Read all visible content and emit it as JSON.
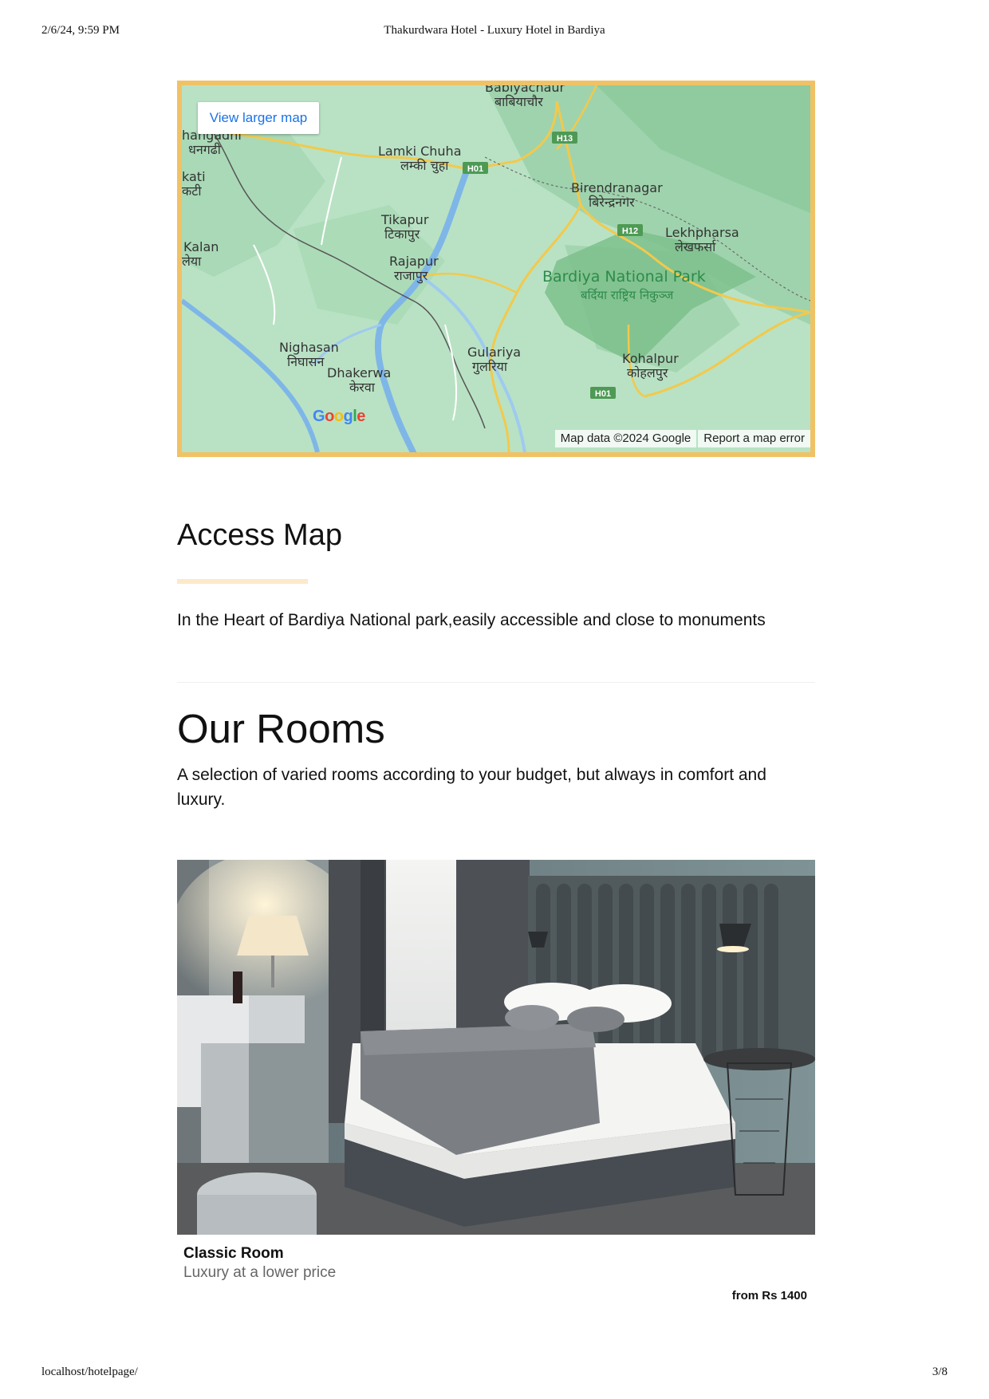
{
  "print_header": {
    "datetime": "2/6/24, 9:59 PM",
    "title": "Thakurdwara Hotel - Luxury Hotel in Bardiya"
  },
  "print_footer": {
    "url": "localhost/hotelpage/",
    "page": "3/8"
  },
  "map": {
    "button_label": "View larger map",
    "attribution": "Map data ©2024 Google",
    "report_label": "Report a map error",
    "logo_text": "Google",
    "places": [
      {
        "name": "Babiyachaur",
        "native": "बाबियाचौर"
      },
      {
        "name": "hangadhi",
        "native": "धनगढी"
      },
      {
        "name": "Lamki Chuha",
        "native": "लम्की चुहा"
      },
      {
        "name": "Birendranagar",
        "native": "बिरेन्द्रनगर"
      },
      {
        "name": "kati",
        "native": "कटी"
      },
      {
        "name": "Tikapur",
        "native": "टिकापुर"
      },
      {
        "name": "Lekhpharsa",
        "native": "लेखफर्सा"
      },
      {
        "name": "Kalan",
        "native": "लेया"
      },
      {
        "name": "Rajapur",
        "native": "राजापुर"
      },
      {
        "name": "Bardiya National Park",
        "native": "बर्दिया राष्ट्रिय निकुञ्ज"
      },
      {
        "name": "Nighasan",
        "native": "निघासन"
      },
      {
        "name": "Gulariya",
        "native": "गुलरिया"
      },
      {
        "name": "Kohalpur",
        "native": "कोहलपुर"
      },
      {
        "name": "Dhakerwa",
        "native": "केरवा"
      }
    ],
    "road_labels": [
      "H13",
      "H01",
      "H12",
      "H01"
    ]
  },
  "access": {
    "heading": "Access Map",
    "text": "In the Heart of Bardiya National park,easily accessible and close to monuments"
  },
  "rooms": {
    "heading": "Our Rooms",
    "intro": "A selection of varied rooms according to your budget, but always in comfort and luxury.",
    "items": [
      {
        "name": "Classic Room",
        "subtitle": "Luxury at a lower price",
        "price": "from Rs 1400"
      }
    ]
  }
}
